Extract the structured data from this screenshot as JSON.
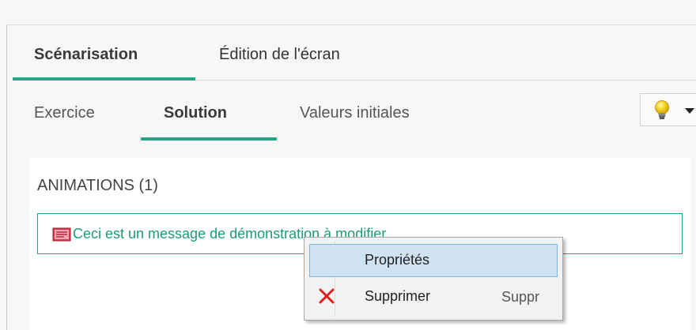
{
  "main_tabs": [
    {
      "label": "Scénarisation",
      "active": true
    },
    {
      "label": "Édition de l'écran",
      "active": false
    }
  ],
  "sub_tabs": [
    {
      "label": "Exercice",
      "active": false
    },
    {
      "label": "Solution",
      "active": true
    },
    {
      "label": "Valeurs initiales",
      "active": false
    }
  ],
  "hint_button": {
    "icon": "lightbulb-icon",
    "dropdown_icon": "caret-down-icon"
  },
  "panel": {
    "title": "ANIMATIONS (1)",
    "items": [
      {
        "icon": "message-icon",
        "label": "Ceci est un message de démonstration à modifier"
      }
    ]
  },
  "context_menu": {
    "items": [
      {
        "label": "Propriétés",
        "shortcut": "",
        "icon": "",
        "highlighted": true
      },
      {
        "label": "Supprimer",
        "shortcut": "Suppr",
        "icon": "delete-icon",
        "highlighted": false
      }
    ]
  },
  "colors": {
    "accent": "#2aa386",
    "link_text": "#1f9a79",
    "menu_highlight": "#cfe3f3",
    "delete_red": "#e02020"
  }
}
